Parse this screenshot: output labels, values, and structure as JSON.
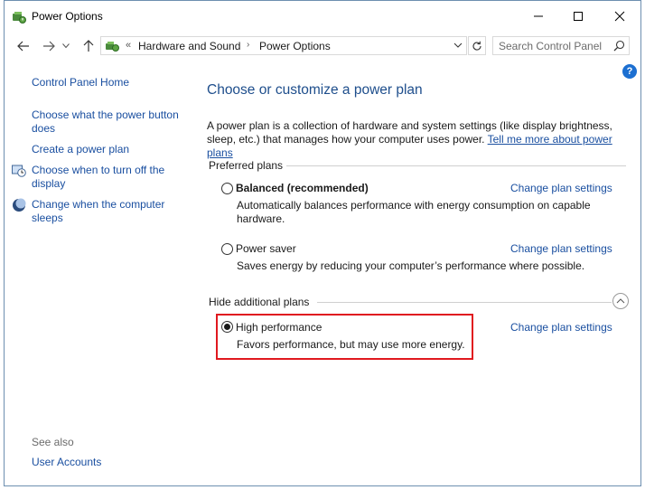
{
  "window": {
    "title": "Power Options"
  },
  "address": {
    "crumbs": [
      "Hardware and Sound",
      "Power Options"
    ],
    "search_placeholder": "Search Control Panel"
  },
  "sidebar": {
    "home": "Control Panel Home",
    "links": [
      "Choose what the power button does",
      "Create a power plan",
      "Choose when to turn off the display",
      "Change when the computer sleeps"
    ],
    "see_also": "See also",
    "user_accounts": "User Accounts"
  },
  "main": {
    "title": "Choose or customize a power plan",
    "intro": "A power plan is a collection of hardware and system settings (like display brightness, sleep, etc.) that manages how your computer uses power. ",
    "intro_link": "Tell me more about power plans",
    "preferred_header": "Preferred plans",
    "additional_header": "Hide additional plans",
    "change_label": "Change plan settings",
    "plans": [
      {
        "name": "Balanced (recommended)",
        "desc": "Automatically balances performance with energy consumption on capable hardware.",
        "selected": false
      },
      {
        "name": "Power saver",
        "desc": "Saves energy by reducing your computer’s performance where possible.",
        "selected": false
      },
      {
        "name": "High performance",
        "desc": "Favors performance, but may use more energy.",
        "selected": true
      }
    ]
  },
  "colors": {
    "link": "#1a4fa0",
    "title": "#1e4e8c",
    "highlight": "#e0191f"
  }
}
